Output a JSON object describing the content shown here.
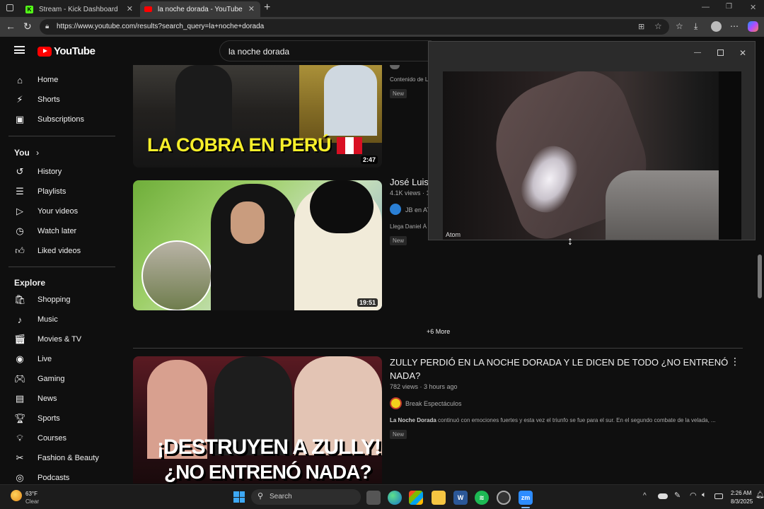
{
  "browser": {
    "tabs": [
      {
        "title": "Stream - Kick Dashboard",
        "favicon": "K"
      },
      {
        "title": "la noche dorada - YouTube"
      }
    ],
    "new_tab": "+",
    "url": "https://www.youtube.com/results?search_query=la+noche+dorada"
  },
  "youtube": {
    "logo": "YouTube",
    "search_query": "la noche dorada"
  },
  "sidebar": {
    "top": [
      {
        "label": "Home",
        "icon": "home-icon"
      },
      {
        "label": "Shorts",
        "icon": "shorts-icon"
      },
      {
        "label": "Subscriptions",
        "icon": "subscriptions-icon"
      }
    ],
    "you_heading": "You",
    "you_chevron": "›",
    "you": [
      {
        "label": "History",
        "icon": "history-icon"
      },
      {
        "label": "Playlists",
        "icon": "playlists-icon"
      },
      {
        "label": "Your videos",
        "icon": "your-videos-icon"
      },
      {
        "label": "Watch later",
        "icon": "watch-later-icon"
      },
      {
        "label": "Liked videos",
        "icon": "liked-videos-icon"
      }
    ],
    "explore_heading": "Explore",
    "explore": [
      {
        "label": "Shopping",
        "icon": "shopping-icon"
      },
      {
        "label": "Music",
        "icon": "music-icon"
      },
      {
        "label": "Movies & TV",
        "icon": "movies-icon"
      },
      {
        "label": "Live",
        "icon": "live-icon"
      },
      {
        "label": "Gaming",
        "icon": "gaming-icon"
      },
      {
        "label": "News",
        "icon": "news-icon"
      },
      {
        "label": "Sports",
        "icon": "sports-icon"
      },
      {
        "label": "Courses",
        "icon": "courses-icon"
      },
      {
        "label": "Fashion & Beauty",
        "icon": "fashion-icon"
      },
      {
        "label": "Podcasts",
        "icon": "podcasts-icon"
      }
    ]
  },
  "results": {
    "video1": {
      "thumb_text": "LA COBRA EN PERÚ",
      "duration": "2:47",
      "desc": "Contenido de L",
      "badge": "New"
    },
    "video2": {
      "title": "José Luis",
      "views": "4.1K views · 1",
      "channel": "JB en AT",
      "desc": "Llega Daniel Á",
      "badge": "New",
      "duration": "19:51"
    },
    "more": "+6 More",
    "video3": {
      "title_line1": "ZULLY PERDIÓ EN LA NOCHE DORADA Y LE DICEN DE TODO ¿NO ENTRENÓ",
      "title_line2": "NADA?",
      "views": "782 views · 3 hours ago",
      "channel": "Break Espectáculos",
      "desc_bold": "La Noche Dorada",
      "desc_rest": " continuó con emociones fuertes y esta vez el triunfo se fue para el sur. En el segundo combate de la velada, ...",
      "badge": "New",
      "thumb_line1": "¡DESTRUYEN A ZULLY!",
      "thumb_line2": "¿NO ENTRENÓ NADA?"
    }
  },
  "pip": {
    "label": "Atom"
  },
  "taskbar": {
    "weather_temp": "63°F",
    "weather_desc": "Clear",
    "search_label": "Search",
    "time": "2:26 AM",
    "date": "8/3/2025",
    "zoom_label": "zm"
  },
  "colors": {
    "yt_red": "#ff0000",
    "kick_green": "#53fc18",
    "bg": "#0f0f0f"
  }
}
